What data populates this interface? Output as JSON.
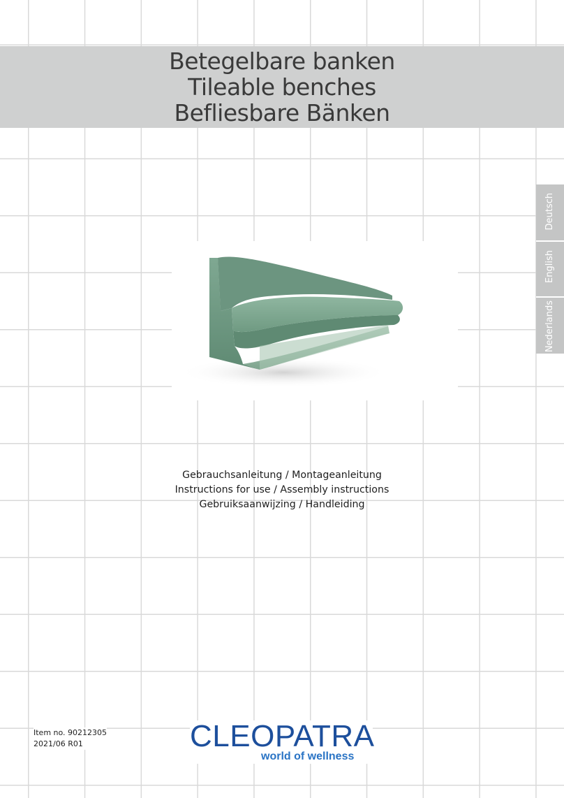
{
  "title": {
    "line1": "Betegelbare banken",
    "line2": "Tileable benches",
    "line3": "Befliesbare Bänken"
  },
  "languages": [
    "Deutsch",
    "English",
    "Nederlands"
  ],
  "subtitles": {
    "line1": "Gebrauchsanleitung / Montageanleitung",
    "line2": "Instructions for use / Assembly instructions",
    "line3": "Gebruiksaanwijzing / Handleiding"
  },
  "item": {
    "number": "Item no.  90212305",
    "revision": "2021/06 R01"
  },
  "logo": {
    "brand": "CLEOPATRA",
    "tagline": "world of wellness"
  },
  "colors": {
    "title_band": "#cfd0d0",
    "lang_tab": "#c4c5c5",
    "bench_green": "#6f9a82",
    "logo_blue": "#1d4f9c",
    "tagline_blue": "#2a74c5"
  }
}
